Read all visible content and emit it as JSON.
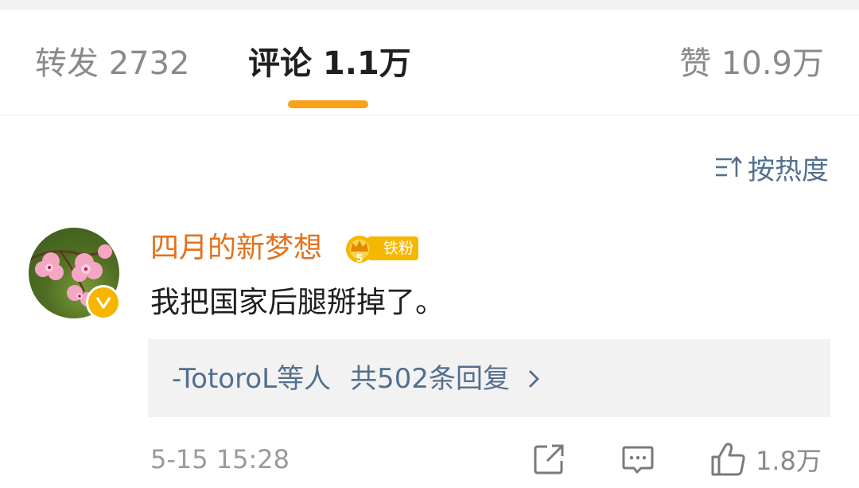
{
  "tabs": {
    "repost": "转发 2732",
    "comments": "评论 1.1万",
    "likes": "赞 10.9万"
  },
  "sort": {
    "label": "按热度",
    "icon": "sort-icon"
  },
  "comment": {
    "username": "四月的新梦想",
    "fan_level": "5",
    "fan_badge": "铁粉",
    "text": "我把国家后腿掰掉了。",
    "replies": {
      "users": "-TotoroL",
      "suffix": "等人",
      "count_text": "共502条回复"
    },
    "time": "5-15 15:28",
    "likes": "1.8万"
  },
  "colors": {
    "accent": "#f8a21a",
    "username": "#e4721d",
    "link": "#536f8f",
    "badge": "#f5b700"
  }
}
